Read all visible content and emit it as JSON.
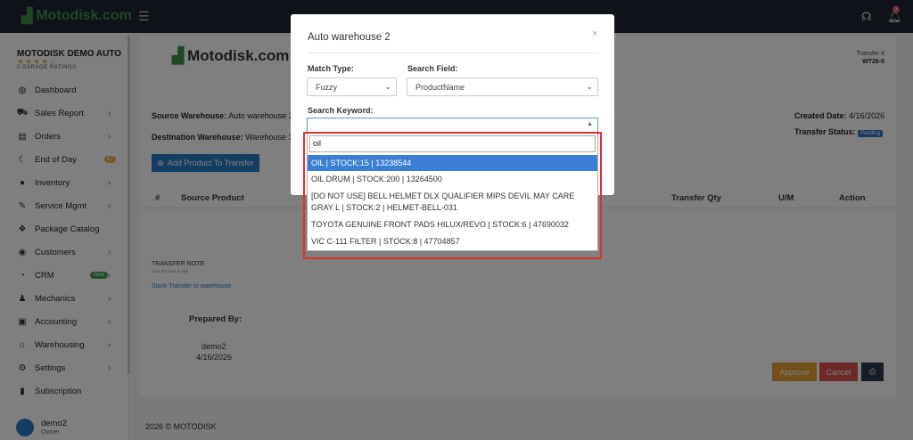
{
  "app": {
    "logo_text": "Motodisk.com"
  },
  "topbar": {
    "notification_count": "3"
  },
  "sidebar": {
    "company_name": "MOTODISK DEMO AUTO",
    "stars": "★★★★☆",
    "ratings": "2 GARAGE RATINGS",
    "items": [
      {
        "label": "Dashboard",
        "icon": "dashboard-icon",
        "glyph": "◍"
      },
      {
        "label": "Sales Report",
        "icon": "cart-icon",
        "glyph": "⛟",
        "chevron": "›"
      },
      {
        "label": "Orders",
        "icon": "orders-icon",
        "glyph": "▤",
        "chevron": "›"
      },
      {
        "label": "End of Day",
        "icon": "moon-icon",
        "glyph": "☾",
        "badge": "67"
      },
      {
        "label": "Inventory",
        "icon": "inventory-icon",
        "glyph": "●",
        "chevron": "›"
      },
      {
        "label": "Service Mgmt",
        "icon": "wrench-icon",
        "glyph": "✎",
        "chevron": "›"
      },
      {
        "label": "Package Catalog",
        "icon": "package-icon",
        "glyph": "❖"
      },
      {
        "label": "Customers",
        "icon": "customers-icon",
        "glyph": "◉",
        "chevron": "›"
      },
      {
        "label": "CRM",
        "icon": "crm-icon",
        "glyph": "◔",
        "badge_new": "New",
        "chevron": "›"
      },
      {
        "label": "Mechanics",
        "icon": "mechanics-icon",
        "glyph": "♟",
        "chevron": "›"
      },
      {
        "label": "Accounting",
        "icon": "accounting-icon",
        "glyph": "▣",
        "chevron": "›"
      },
      {
        "label": "Warehousing",
        "icon": "warehouse-icon",
        "glyph": "⌂",
        "chevron": "›"
      },
      {
        "label": "Settings",
        "icon": "settings-icon",
        "glyph": "⚙",
        "chevron": "›"
      },
      {
        "label": "Subscription",
        "icon": "subscription-icon",
        "glyph": "▮"
      }
    ],
    "user_name": "demo2",
    "user_role": "Owner"
  },
  "transfer": {
    "logo_text": "Motodisk.com",
    "number_label": "Transfer #",
    "number": "WT26-5",
    "source_label": "Source Warehouse:",
    "source_value": "Auto warehouse 2",
    "dest_label": "Destination Warehouse:",
    "dest_value": "Warehouse 3",
    "created_label": "Created Date:",
    "created_value": "4/16/2026",
    "status_label": "Transfer Status:",
    "status_value": "Pending",
    "add_button": "Add Product To Transfer",
    "columns": [
      "#",
      "Source Product",
      "Transfer Qty",
      "U/M",
      "Action"
    ],
    "note_title": "TRANSFER NOTE",
    "note_hint": "Click the note to edit",
    "note_text": "Stock Transfer to warehouse",
    "prepared_label": "Prepared By:",
    "prepared_name": "demo2",
    "prepared_date": "4/16/2026",
    "approve_label": "Approve",
    "cancel_label": "Cancel",
    "footer": "2026 © MOTODISK"
  },
  "modal": {
    "title": "Auto warehouse 2",
    "close": "×",
    "match_type_label": "Match Type:",
    "match_type_value": "Fuzzy",
    "search_field_label": "Search Field:",
    "search_field_value": "ProductName",
    "keyword_label": "Search Keyword:",
    "dropdown_search_value": "oil",
    "options": [
      "OIL | STOCK:15 | 13238544",
      "OIL DRUM | STOCK:200 | 13264500",
      "[DO NOT USE] BELL HELMET DLX QUALIFIER MIPS DEVIL MAY CARE GRAY L | STOCK:2 | HELMET-BELL-031",
      "TOYOTA GENUINE FRONT PADS HILUX/REVO | STOCK:6 | 47690032",
      "VIC C-111 FILTER | STOCK:8 | 47704857"
    ]
  },
  "colors": {
    "accent": "#2b7bc4",
    "brand": "#3d8e4e",
    "approve": "#e0a030",
    "cancel": "#d9534f",
    "highlight": "#3b7fd4"
  }
}
